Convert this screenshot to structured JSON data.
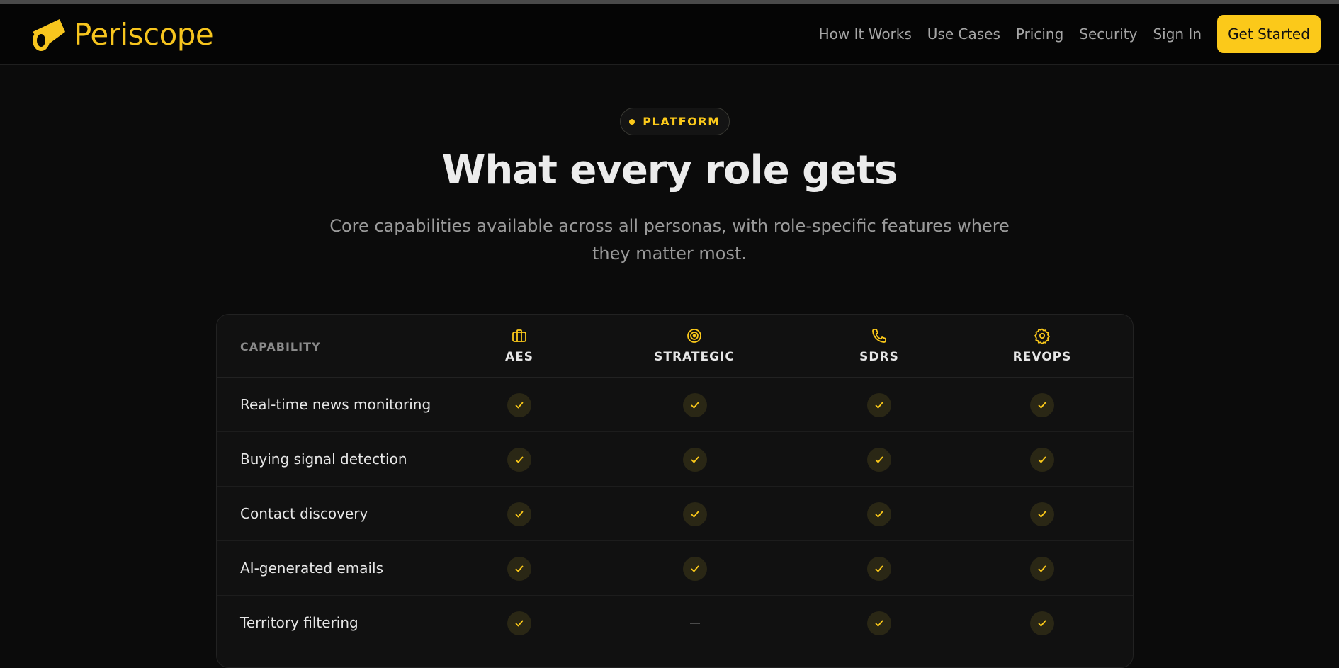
{
  "brand": {
    "name": "Periscope",
    "accent": "#fbc91a"
  },
  "nav": {
    "links": [
      "How It Works",
      "Use Cases",
      "Pricing",
      "Security",
      "Sign In"
    ],
    "cta": "Get Started"
  },
  "hero": {
    "badge": "PLATFORM",
    "title": "What every role gets",
    "subtitle": "Core capabilities available across all personas, with role-specific features where they matter most."
  },
  "table": {
    "capability_header": "CAPABILITY",
    "columns": [
      {
        "label": "AES",
        "icon": "briefcase-icon"
      },
      {
        "label": "STRATEGIC",
        "icon": "target-icon"
      },
      {
        "label": "SDRS",
        "icon": "phone-icon"
      },
      {
        "label": "REVOPS",
        "icon": "gear-icon"
      }
    ],
    "rows": [
      {
        "label": "Real-time news monitoring",
        "values": [
          true,
          true,
          true,
          true
        ]
      },
      {
        "label": "Buying signal detection",
        "values": [
          true,
          true,
          true,
          true
        ]
      },
      {
        "label": "Contact discovery",
        "values": [
          true,
          true,
          true,
          true
        ]
      },
      {
        "label": "AI-generated emails",
        "values": [
          true,
          true,
          true,
          true
        ]
      },
      {
        "label": "Territory filtering",
        "values": [
          true,
          false,
          true,
          true
        ]
      }
    ]
  }
}
